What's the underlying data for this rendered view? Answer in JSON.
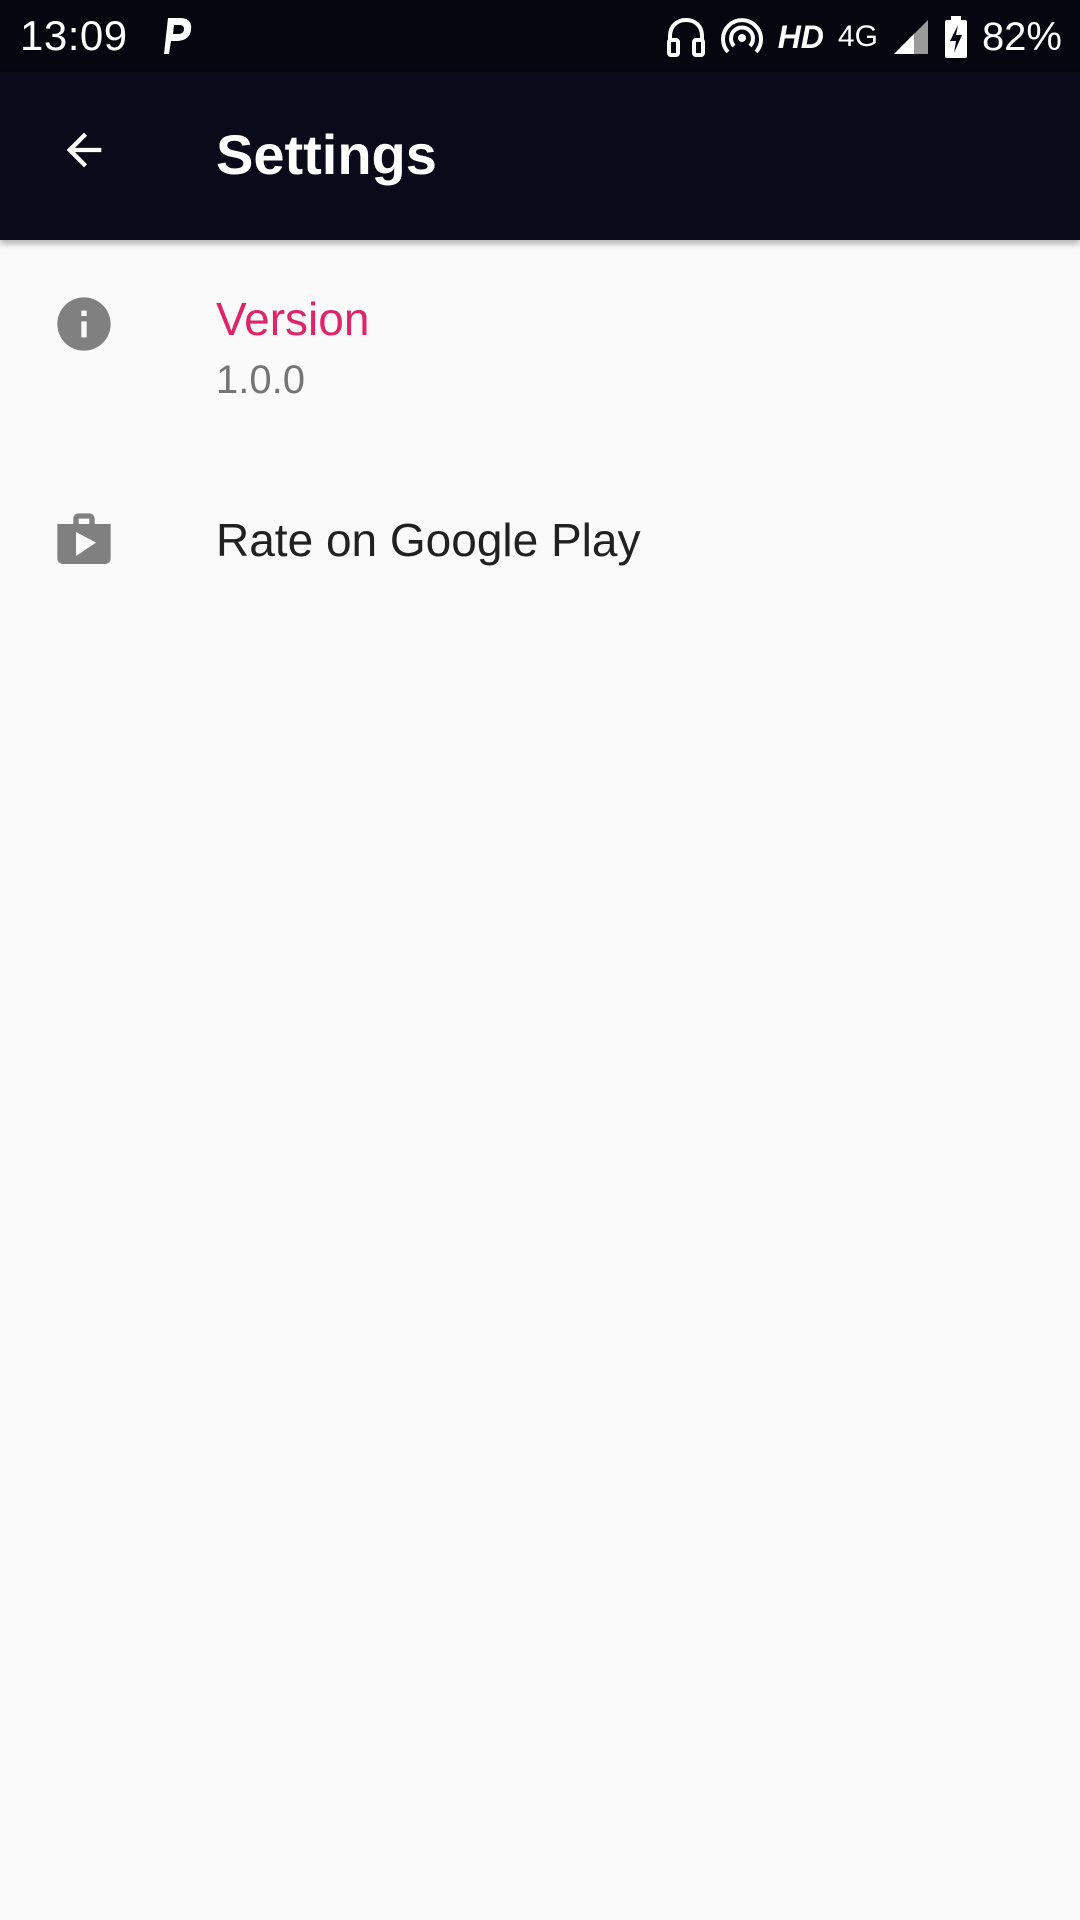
{
  "status_bar": {
    "time": "13:09",
    "hd_label": "HD",
    "network_label": "4G",
    "battery_percent": "82%",
    "icons": [
      "p-app-icon",
      "headphones-icon",
      "hotspot-icon",
      "signal-icon",
      "battery-charging-icon"
    ]
  },
  "app_bar": {
    "title": "Settings",
    "back_icon": "arrow-back-icon"
  },
  "settings": {
    "items": [
      {
        "icon": "info-icon",
        "title": "Version",
        "summary": "1.0.0"
      },
      {
        "icon": "play-store-bag-icon",
        "title": "Rate on Google Play"
      }
    ]
  },
  "colors": {
    "status_bar_bg": "#05060f",
    "app_bar_bg": "#0a0b1a",
    "accent": "#e0246a",
    "page_bg": "#fafafa",
    "icon_gray": "#808080"
  }
}
